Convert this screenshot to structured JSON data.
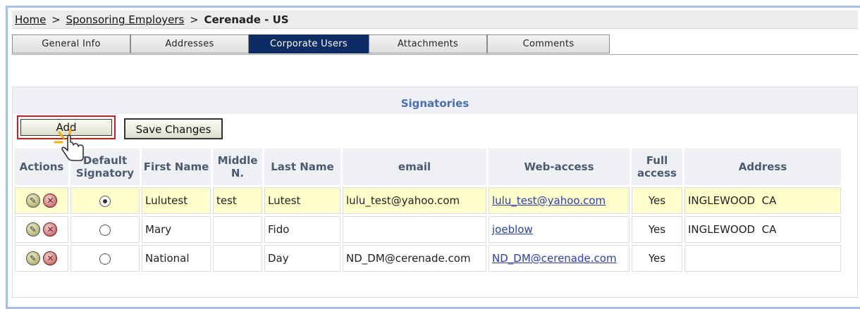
{
  "breadcrumb": {
    "home": "Home",
    "sep1": ">",
    "employers": "Sponsoring Employers",
    "sep2": ">",
    "current": "Cerenade - US"
  },
  "tabs": [
    {
      "label": "General Info"
    },
    {
      "label": "Addresses"
    },
    {
      "label": "Corporate Users",
      "active": true
    },
    {
      "label": "Attachments"
    },
    {
      "label": "Comments"
    }
  ],
  "section": {
    "title": "Signatories"
  },
  "buttons": {
    "add": "Add",
    "save": "Save Changes"
  },
  "table": {
    "headers": [
      "Actions",
      "Default Signatory",
      "First Name",
      "Middle N.",
      "Last Name",
      "email",
      "Web-access",
      "Full access",
      "Address"
    ],
    "rows": [
      {
        "default": true,
        "first": "Lulutest",
        "middle": "test",
        "last": "Lutest",
        "email": "lulu_test@yahoo.com",
        "web": "lulu_test@yahoo.com",
        "full": "Yes",
        "address": "INGLEWOOD  CA"
      },
      {
        "default": false,
        "first": "Mary",
        "middle": "",
        "last": "Fido",
        "email": "",
        "web": "joeblow",
        "full": "Yes",
        "address": "INGLEWOOD  CA"
      },
      {
        "default": false,
        "first": "National",
        "middle": "",
        "last": "Day",
        "email": "ND_DM@cerenade.com",
        "web": "ND_DM@cerenade.com",
        "full": "Yes",
        "address": ""
      }
    ]
  },
  "icons": {
    "edit": "edit-icon",
    "delete": "delete-icon",
    "cursor": "hand-pointer-icon"
  },
  "colors": {
    "active_tab": "#0d2c66",
    "section_title": "#4a6fb5",
    "highlight_row": "#ffffcc",
    "add_outline": "#c02020"
  }
}
